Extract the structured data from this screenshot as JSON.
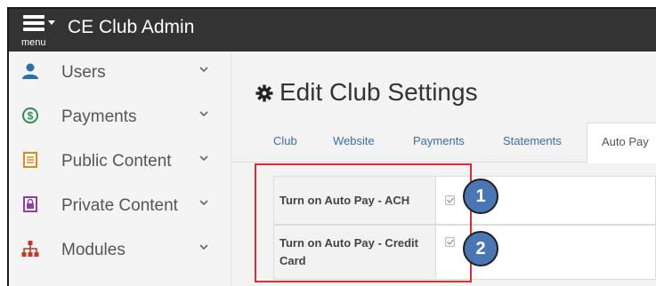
{
  "header": {
    "menu_label": "menu",
    "app_title": "CE Club Admin"
  },
  "sidebar": {
    "items": [
      {
        "label": "Users",
        "icon": "user-icon",
        "color": "#2a6fb0"
      },
      {
        "label": "Payments",
        "icon": "dollar-circle-icon",
        "color": "#2e8b57"
      },
      {
        "label": "Public Content",
        "icon": "document-icon",
        "color": "#e08a1e"
      },
      {
        "label": "Private Content",
        "icon": "locked-document-icon",
        "color": "#8e3fa8"
      },
      {
        "label": "Modules",
        "icon": "sitemap-icon",
        "color": "#c0392b"
      }
    ]
  },
  "main": {
    "title": "Edit Club Settings",
    "tabs": [
      {
        "label": "Club",
        "active": false
      },
      {
        "label": "Website",
        "active": false
      },
      {
        "label": "Payments",
        "active": false
      },
      {
        "label": "Statements",
        "active": false
      },
      {
        "label": "Auto Pay",
        "active": true
      }
    ],
    "settings": [
      {
        "label": "Turn on Auto Pay - ACH",
        "checked": true,
        "callout": "1"
      },
      {
        "label": "Turn on Auto Pay - Credit Card",
        "checked": true,
        "callout": "2"
      }
    ]
  },
  "colors": {
    "topbar": "#333333",
    "link": "#3a6ea5",
    "callout": "#4a77b4",
    "highlight": "#e02a34"
  }
}
